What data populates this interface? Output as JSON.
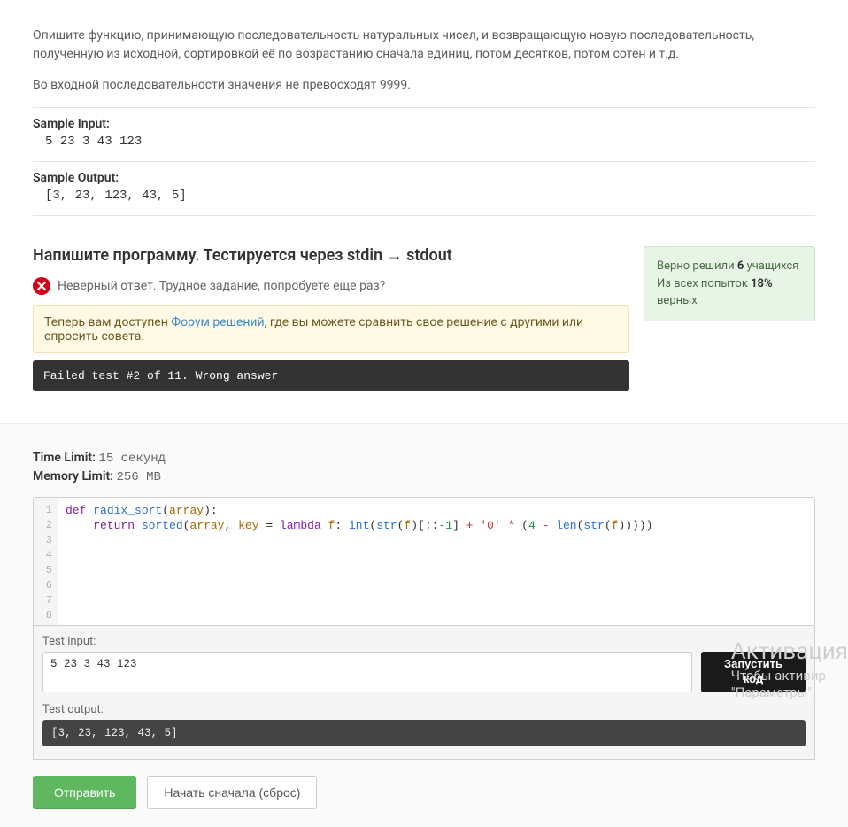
{
  "description": {
    "p1": "Опишите функцию, принимающую последовательность натуральных чисел, и возвращающую новую последовательность, полученную из исходной, сортировкой её по возрастанию сначала единиц, потом десятков, потом сотен и т.д.",
    "p2": "Во входной последовательности значения не превосходят 9999."
  },
  "sample": {
    "input_label": "Sample Input:",
    "input_value": "5 23 3 43 123",
    "output_label": "Sample Output:",
    "output_value": "[3, 23, 123, 43, 5]"
  },
  "task": {
    "title": "Напишите программу. Тестируется через stdin → stdout",
    "wrong_text": "Неверный ответ. Трудное задание, попробуете еще раз?",
    "forum": {
      "prefix": "Теперь вам доступен ",
      "link": "Форум решений",
      "suffix": ", где вы можете сравнить свое решение с другими или спросить совета."
    },
    "failed_text": "Failed test #2 of 11. Wrong answer"
  },
  "stats": {
    "line1_a": "Верно решили ",
    "line1_b": "6",
    "line1_c": " учащихся",
    "line2_a": "Из всех попыток ",
    "line2_b": "18%",
    "line2_c": " верных"
  },
  "limits": {
    "time_label": "Time Limit:",
    "time_value": "15 секунд",
    "mem_label": "Memory Limit:",
    "mem_value": "256 MB"
  },
  "code": {
    "gutter": [
      "1",
      "2",
      "3",
      "4",
      "5",
      "6",
      "7",
      "8"
    ],
    "tokens_line1": {
      "def": "def",
      "fn": "radix_sort",
      "open": "(",
      "arg": "array",
      "close": "):"
    },
    "tokens_line2": {
      "indent": "    ",
      "ret": "return",
      "sp": " ",
      "sorted": "sorted",
      "open": "(",
      "arg": "array",
      "comma": ", ",
      "key": "key",
      "sp2": " ",
      "eq": "=",
      "sp3": " ",
      "lambda": "lambda",
      "sp4": " ",
      "f": "f",
      "colon": ": ",
      "int": "int",
      "op1": "(",
      "str1": "str",
      "op2": "(",
      "f2": "f",
      "cl1": ")[::",
      "neg1": "-1",
      "cl2": "] ",
      "plus": "+",
      "sp5": " ",
      "lit": "'0'",
      "sp6": " ",
      "star": "*",
      "sp7": " (",
      "four": "4",
      "sp8": " ",
      "minus": "-",
      "sp9": " ",
      "len": "len",
      "op3": "(",
      "str2": "str",
      "op4": "(",
      "f3": "f",
      "cl3": ")))))"
    }
  },
  "test": {
    "input_label": "Test input:",
    "input_value": "5 23 3 43 123",
    "run_label": "Запустить код",
    "output_label": "Test output:",
    "output_value": "[3, 23, 123, 43, 5]"
  },
  "actions": {
    "submit": "Отправить",
    "reset": "Начать сначала (сброс)"
  },
  "watermark": {
    "w1": "Активация",
    "w2": "Чтобы активир",
    "w3": "\"Параметры\"."
  }
}
